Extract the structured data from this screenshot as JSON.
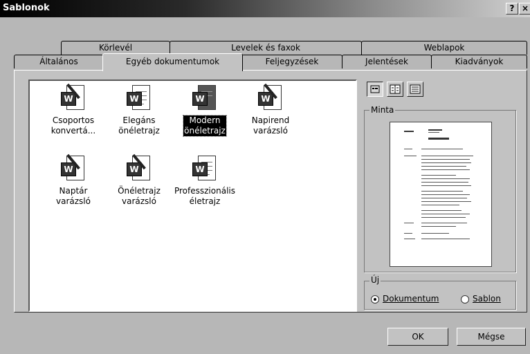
{
  "window": {
    "title": "Sablonok",
    "help_label": "?",
    "close_label": "×"
  },
  "tabs_back": [
    "Körlevél",
    "Levelek és faxok",
    "Weblapok"
  ],
  "tabs_front": [
    "Általános",
    "Egyéb dokumentumok",
    "Feljegyzések",
    "Jelentések",
    "Kiadványok"
  ],
  "active_tab": "Egyéb dokumentumok",
  "items": [
    {
      "label": "Csoportos\nkonvertá...",
      "icon": "wizard-icon"
    },
    {
      "label": "Elegáns\nönéletrajz",
      "icon": "word-template-icon"
    },
    {
      "label": "Modern\nönéletrajz",
      "icon": "word-template-icon",
      "selected": true
    },
    {
      "label": "Napirend\nvarázsló",
      "icon": "wizard-icon"
    },
    {
      "label": "Naptár\nvarázsló",
      "icon": "wizard-icon"
    },
    {
      "label": "Önéletrajz\nvarázsló",
      "icon": "wizard-icon"
    },
    {
      "label": "Professzionális\néletrajz",
      "icon": "word-template-icon"
    }
  ],
  "view_buttons": [
    "large-icons-icon",
    "list-icon",
    "details-icon"
  ],
  "preview": {
    "label": "Minta"
  },
  "new_group": {
    "label": "Új",
    "options": [
      "Dokumentum",
      "Sablon"
    ],
    "selected": "Dokumentum"
  },
  "buttons": {
    "ok": "OK",
    "cancel": "Mégse"
  }
}
